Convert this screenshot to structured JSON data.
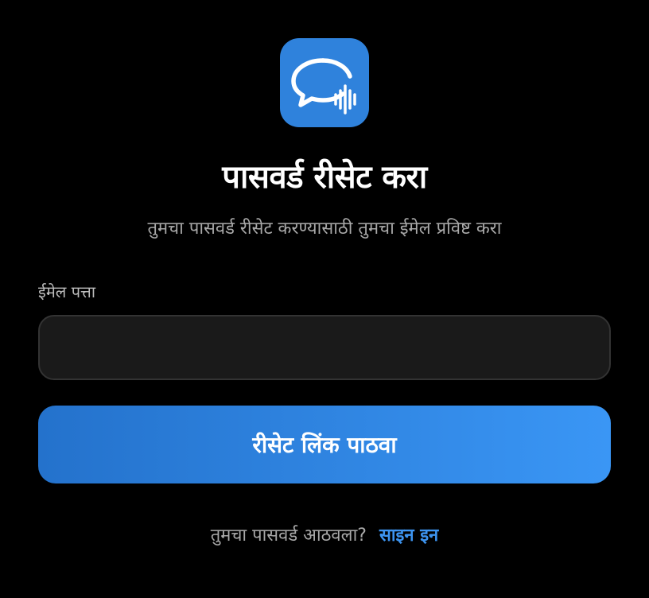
{
  "app": {
    "logo_icon": "chat-bubble-soundwave-icon",
    "accent_color": "#2f82dc"
  },
  "header": {
    "title": "पासवर्ड रीसेट करा",
    "subtitle": "तुमचा पासवर्ड रीसेट करण्यासाठी तुमचा ईमेल प्रविष्ट करा"
  },
  "form": {
    "email_label": "ईमेल पत्ता",
    "email_value": "",
    "submit_label": "रीसेट लिंक पाठवा"
  },
  "footer": {
    "prompt": "तुमचा पासवर्ड आठवला?",
    "signin_link": "साइन इन"
  },
  "colors": {
    "background": "#000000",
    "button_gradient_start": "#2472cc",
    "button_gradient_end": "#3a96f5",
    "link": "#3d94f0"
  }
}
